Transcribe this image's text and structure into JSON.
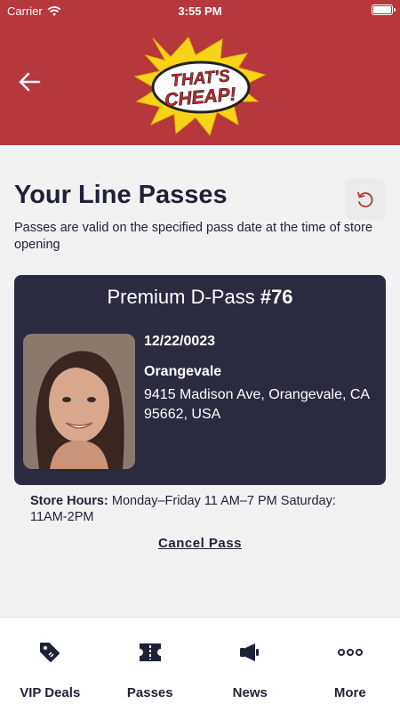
{
  "status_bar": {
    "carrier": "Carrier",
    "time": "3:55 PM"
  },
  "header": {
    "logo_text_line1": "THAT'S",
    "logo_text_line2": "CHEAP!"
  },
  "page": {
    "title": "Your Line Passes",
    "subtitle": "Passes are valid on the specified pass date at the time of store opening"
  },
  "pass": {
    "title_prefix": "Premium D-Pass",
    "number": "#76",
    "date": "12/22/0023",
    "store_name": "Orangevale",
    "address": "9415 Madison Ave, Orangevale, CA 95662, USA"
  },
  "store_hours": {
    "label": "Store Hours:",
    "value": "Monday–Friday 11 AM–7 PM Saturday: 11AM-2PM"
  },
  "cancel_label": "Cancel Pass",
  "tabs": [
    {
      "label": "VIP Deals",
      "icon": "tag-icon"
    },
    {
      "label": "Passes",
      "icon": "ticket-icon"
    },
    {
      "label": "News",
      "icon": "megaphone-icon"
    },
    {
      "label": "More",
      "icon": "more-icon"
    }
  ],
  "colors": {
    "header": "#b6383c",
    "card": "#2b2b40",
    "text": "#1f2137",
    "accent": "#b6383c"
  }
}
